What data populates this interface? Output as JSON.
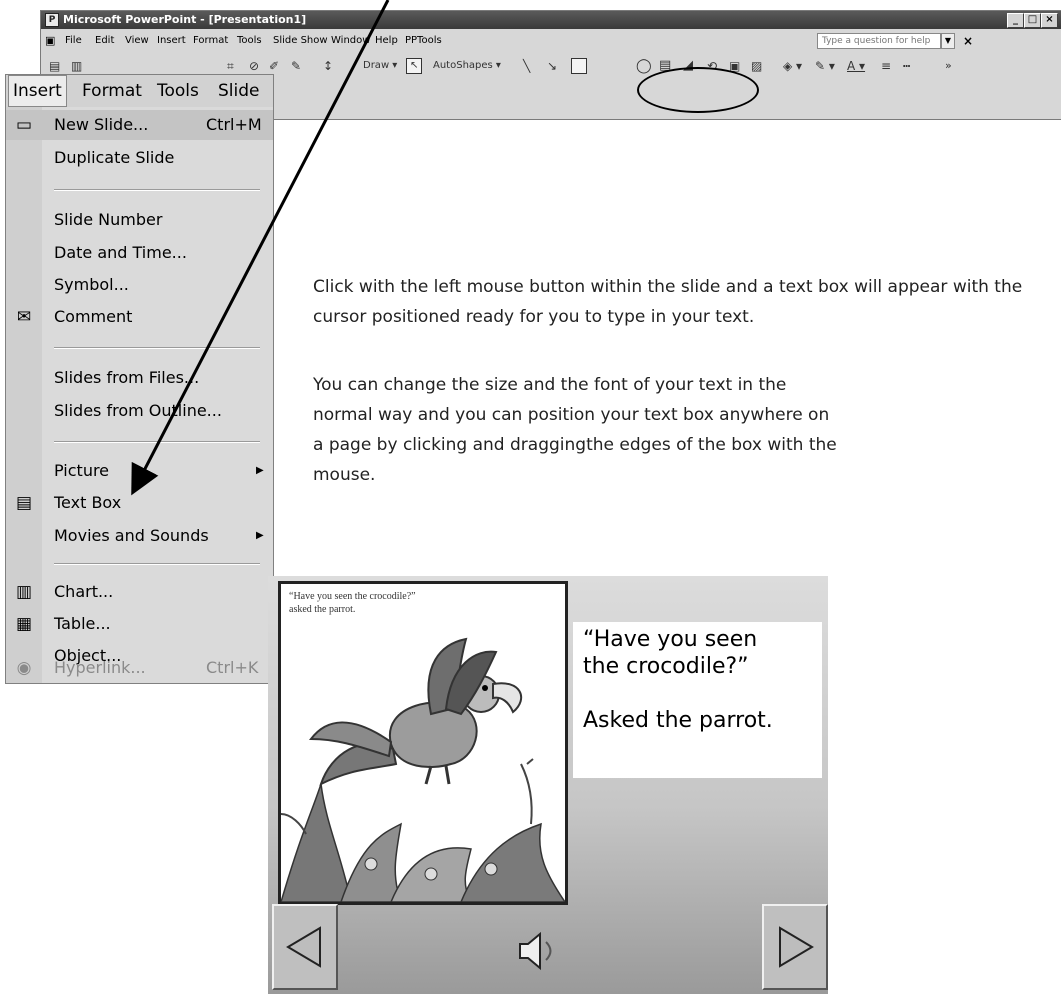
{
  "window": {
    "title": "Microsoft PowerPoint - [Presentation1]",
    "app_icon": "powerpoint-icon",
    "controls": [
      "minimize",
      "maximize",
      "close"
    ]
  },
  "menubar": {
    "items": [
      "File",
      "Edit",
      "View",
      "Insert",
      "Format",
      "Tools",
      "Slide Show",
      "Window",
      "Help",
      "PPTools"
    ],
    "help_placeholder": "Type a question for help"
  },
  "drawing_toolbar": {
    "draw_label": "Draw",
    "autoshapes_label": "AutoShapes",
    "tools": [
      "line-icon",
      "arrow-icon",
      "rectangle-icon",
      "oval-icon",
      "text-box-icon",
      "wordart-icon"
    ]
  },
  "insert_menu": {
    "menubar": [
      "Insert",
      "Format",
      "Tools",
      "Slide S"
    ],
    "items": [
      {
        "label": "New Slide...",
        "shortcut": "Ctrl+M",
        "icon": "new-slide-icon"
      },
      {
        "label": "Duplicate Slide"
      },
      {
        "label": "Slide Number"
      },
      {
        "label": "Date and Time..."
      },
      {
        "label": "Symbol..."
      },
      {
        "label": "Comment",
        "icon": "comment-icon"
      },
      {
        "label": "Slides from Files..."
      },
      {
        "label": "Slides from Outline..."
      },
      {
        "label": "Picture",
        "submenu": true
      },
      {
        "label": "Text Box",
        "icon": "text-box-icon"
      },
      {
        "label": "Movies and Sounds",
        "submenu": true
      },
      {
        "label": "Chart...",
        "icon": "chart-icon"
      },
      {
        "label": "Table...",
        "icon": "table-icon"
      },
      {
        "label": "Object..."
      },
      {
        "label": "Hyperlink...",
        "shortcut": "Ctrl+K",
        "icon": "hyperlink-icon",
        "disabled": true
      }
    ]
  },
  "instructions": {
    "para1": "Click with the left mouse button within the slide and a text box will appear with the cursor positioned ready for you to type in your text.",
    "para2": "You can change the size and the font of your text in the normal way and you can position your text box anywhere on a page by clicking and draggingthe edges of the box with the mouse."
  },
  "slide": {
    "page_caption": "“Have you seen the crocodile?” asked the parrot.",
    "text_line1": "“Have you seen",
    "text_line2": "the crocodile?”",
    "text_line3": "Asked the parrot.",
    "nav": [
      "previous-arrow-icon",
      "speaker-icon",
      "next-arrow-icon"
    ]
  }
}
